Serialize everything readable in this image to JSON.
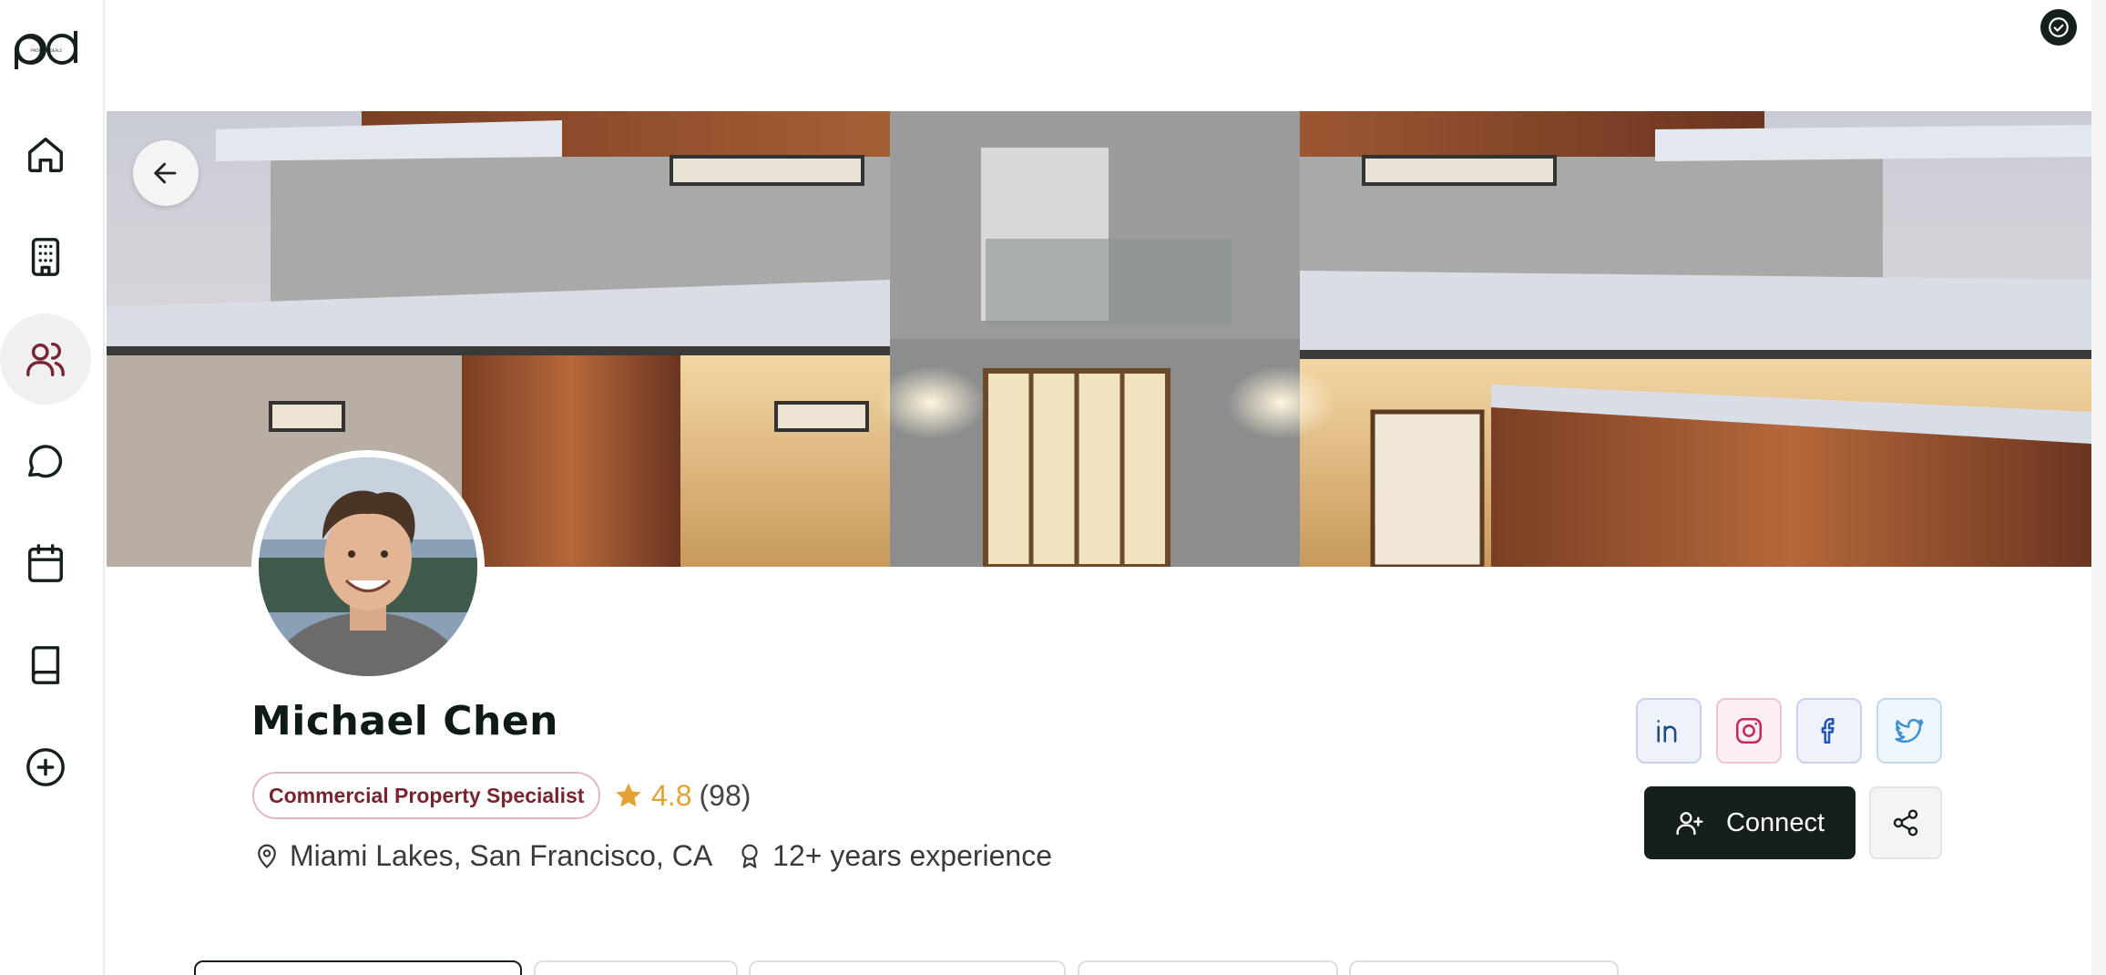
{
  "app": {
    "logo_text": "PROPERTYDEALS"
  },
  "sidebar": {
    "items": [
      {
        "icon": "home-icon",
        "label": "Home"
      },
      {
        "icon": "building-icon",
        "label": "Properties"
      },
      {
        "icon": "users-icon",
        "label": "Agents",
        "active": true
      },
      {
        "icon": "message-icon",
        "label": "Messages"
      },
      {
        "icon": "calendar-icon",
        "label": "Calendar"
      },
      {
        "icon": "book-icon",
        "label": "Resources"
      },
      {
        "icon": "plus-circle-icon",
        "label": "Add"
      }
    ]
  },
  "profile": {
    "name": "Michael Chen",
    "specialty": "Commercial Property Specialist",
    "rating": "4.8",
    "review_count": "(98)",
    "location": "Miami Lakes, San Francisco, CA",
    "experience": "12+ years experience"
  },
  "actions": {
    "connect_label": "Connect",
    "share_icon": "share-icon"
  },
  "social": [
    "linkedin-icon",
    "instagram-icon",
    "facebook-icon",
    "twitter-icon"
  ],
  "colors": {
    "primary": "#15201c",
    "badge_text": "#7b2431",
    "badge_border": "#e3b7bc",
    "star": "#e3a233",
    "linkedin": "#1f4a8a",
    "instagram": "#c5285a",
    "facebook": "#2456b8",
    "twitter": "#3d8fd6"
  }
}
